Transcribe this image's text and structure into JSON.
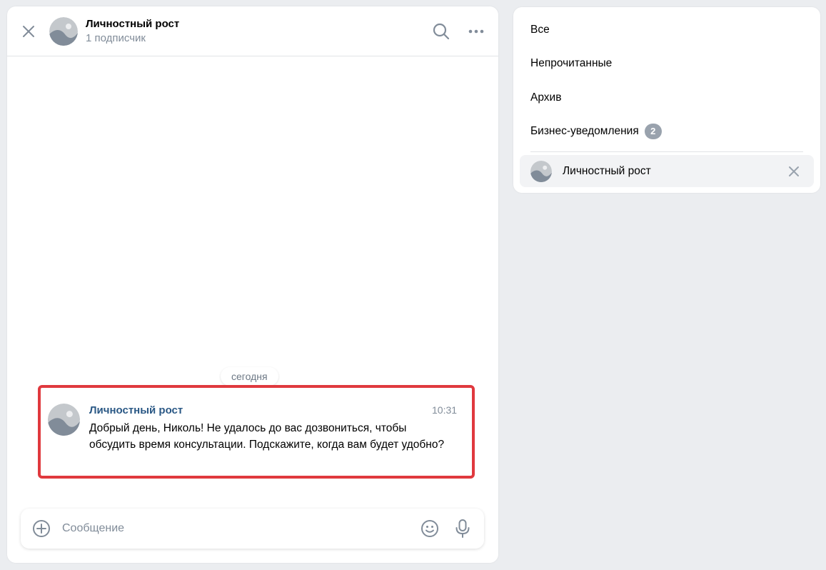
{
  "chat": {
    "title": "Личностный рост",
    "subscribers": "1 подписчик",
    "date_separator": "сегодня",
    "message": {
      "author": "Личностный рост",
      "time": "10:31",
      "text": "Добрый день, Николь! Не удалось до вас дозвониться, чтобы обсудить время консультации. Подскажите, когда вам будет удобно?"
    },
    "composer": {
      "placeholder": "Сообщение"
    }
  },
  "filters": {
    "items": [
      {
        "label": "Все"
      },
      {
        "label": "Непрочитанные"
      },
      {
        "label": "Архив"
      },
      {
        "label": "Бизнес-уведомления",
        "badge": "2"
      }
    ],
    "selected_folder": {
      "label": "Личностный рост"
    }
  },
  "colors": {
    "accent_author": "#2a5885",
    "highlight_border": "#e0393e",
    "icon": "#818c99"
  },
  "icons": [
    "close-icon",
    "search-icon",
    "more-icon",
    "attach-icon",
    "emoji-icon",
    "mic-icon",
    "avatar-icon"
  ]
}
